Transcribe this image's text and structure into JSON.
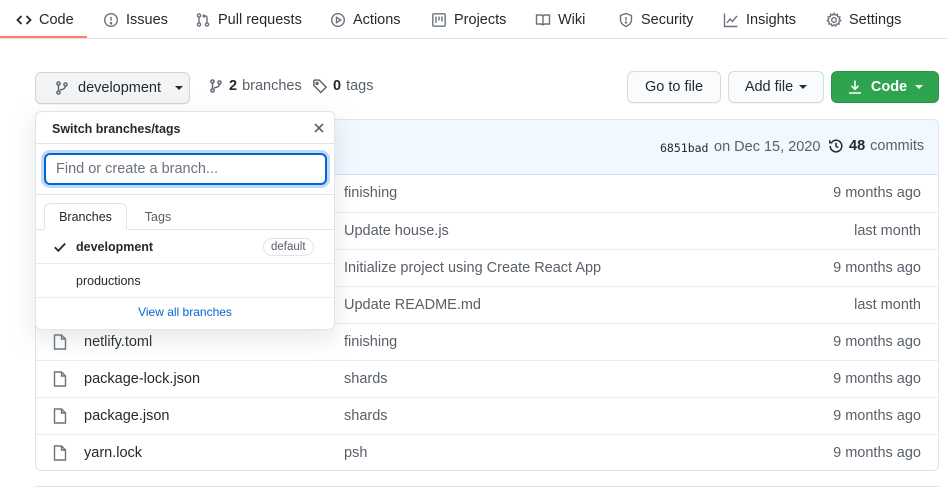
{
  "tabs": [
    {
      "label": "Code",
      "icon": "code-icon"
    },
    {
      "label": "Issues",
      "icon": "issue-icon"
    },
    {
      "label": "Pull requests",
      "icon": "pull-request-icon"
    },
    {
      "label": "Actions",
      "icon": "play-icon"
    },
    {
      "label": "Projects",
      "icon": "project-icon"
    },
    {
      "label": "Wiki",
      "icon": "book-icon"
    },
    {
      "label": "Security",
      "icon": "shield-icon"
    },
    {
      "label": "Insights",
      "icon": "graph-icon"
    },
    {
      "label": "Settings",
      "icon": "gear-icon"
    }
  ],
  "file_nav": {
    "current_branch": "development",
    "branch_count": "2",
    "branch_label": "branches",
    "tag_count": "0",
    "tag_label": "tags",
    "goto_file": "Go to file",
    "add_file": "Add file",
    "code_button": "Code"
  },
  "commit": {
    "sha": "6851bad",
    "date": "on Dec 15, 2020",
    "count": "48",
    "count_label": "commits"
  },
  "files": [
    {
      "name": "",
      "message": "finishing",
      "age": "9 months ago"
    },
    {
      "name": "",
      "message": "Update house.js",
      "age": "last month"
    },
    {
      "name": "",
      "message": "Initialize project using Create React App",
      "age": "9 months ago"
    },
    {
      "name": "",
      "message": "Update README.md",
      "age": "last month"
    },
    {
      "name": "netlify.toml",
      "message": "finishing",
      "age": "9 months ago"
    },
    {
      "name": "package-lock.json",
      "message": "shards",
      "age": "9 months ago"
    },
    {
      "name": "package.json",
      "message": "shards",
      "age": "9 months ago"
    },
    {
      "name": "yarn.lock",
      "message": "psh",
      "age": "9 months ago"
    }
  ],
  "branch_menu": {
    "title": "Switch branches/tags",
    "filter_placeholder": "Find or create a branch...",
    "tab_branches": "Branches",
    "tab_tags": "Tags",
    "items": [
      {
        "name": "development",
        "badge": "default",
        "selected": true
      },
      {
        "name": "productions",
        "badge": "",
        "selected": false
      }
    ],
    "view_all": "View all branches"
  },
  "colors": {
    "accent_underline": "#f9826c",
    "code_button": "#2ea44f",
    "link": "#0366d6",
    "commit_bar": "#f1f8ff"
  }
}
